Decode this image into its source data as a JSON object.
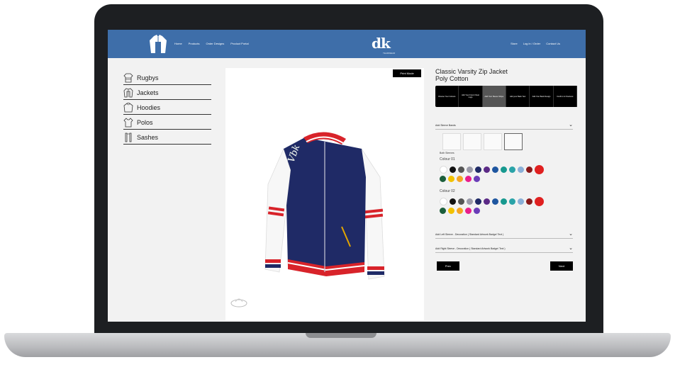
{
  "nav": {
    "links": [
      "Home",
      "Products",
      "Order Designs",
      "Product Portal"
    ],
    "brand": "dk",
    "brand_sub": "TEAMWEAR",
    "right_links": [
      "Store",
      "Log in / Order",
      "Contact Us"
    ]
  },
  "sidebar": {
    "items": [
      {
        "label": "Rugbys",
        "icon": "rugby-shirt-icon"
      },
      {
        "label": "Jackets",
        "icon": "jacket-icon"
      },
      {
        "label": "Hoodies",
        "icon": "hoodie-icon"
      },
      {
        "label": "Polos",
        "icon": "polo-icon"
      },
      {
        "label": "Sashes",
        "icon": "sash-icon"
      }
    ]
  },
  "canvas": {
    "print_label": "Print Mode"
  },
  "product": {
    "title_line1": "Classic Varsity Zip Jacket",
    "title_line2": "Poly Cotton",
    "tabs": [
      {
        "label": "Choose Your Colours",
        "active": false
      },
      {
        "label": "Add Your Front Chest Logo",
        "active": false
      },
      {
        "label": "Add Your Sleeve Stripe",
        "active": true
      },
      {
        "label": "Add your Back Text",
        "active": false
      },
      {
        "label": "Add Your Back Design",
        "active": false
      },
      {
        "label": "Confirm & Checkout",
        "active": false
      }
    ],
    "sleeve_bands_label": "Add Sleeve Bands",
    "both_sleeves_label": "Both Sleeves",
    "colour1_label": "Colour 01",
    "colour2_label": "Colour 02",
    "left_sleeve_label": "Add Left Sleeve - Decoration ( Standard Artwork Badge/ Text )",
    "right_sleeve_label": "Add Right Sleeve - Decoration ( Standard Artwork Badge/ Text )",
    "prev_label": "Prev",
    "next_label": "Next"
  },
  "palette": {
    "row1": [
      "#ffffff",
      "#111111",
      "#555555",
      "#9a9aa8",
      "#1f2a66",
      "#5b2a86",
      "#1e56a0",
      "#17998f",
      "#2aa3a8",
      "#8ab0d8",
      "#8b1a1a",
      "#e02020"
    ],
    "row2": [
      "#1b5e3b",
      "#f2c200",
      "#f5a623",
      "#e91e8c",
      "#6a3db8"
    ]
  },
  "colors": {
    "nav_blue": "#3e6ea9",
    "jacket_navy": "#1f2a66",
    "jacket_red": "#d8232a"
  }
}
